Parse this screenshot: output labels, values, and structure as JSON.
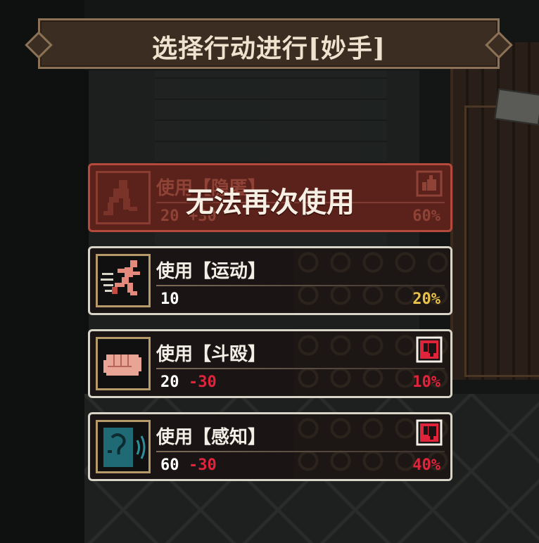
{
  "header": {
    "title": "选择行动进行[妙手]"
  },
  "options": [
    {
      "label": "使用【隐匿】",
      "base": "20",
      "modifier": "+30",
      "chance": "60%",
      "icon": "sneak-icon",
      "badge": "thumbs-up-icon",
      "disabled": true,
      "overlay": "无法再次使用"
    },
    {
      "label": "使用【运动】",
      "base": "10",
      "modifier": "",
      "chance": "20%",
      "chance_color": "#e8c04a",
      "icon": "running-icon",
      "badge": "",
      "disabled": false
    },
    {
      "label": "使用【斗殴】",
      "base": "20",
      "modifier": "-30",
      "chance": "10%",
      "chance_color": "#e0243c",
      "icon": "fist-icon",
      "badge": "thumbs-down-icon",
      "disabled": false
    },
    {
      "label": "使用【感知】",
      "base": "60",
      "modifier": "-30",
      "chance": "40%",
      "chance_color": "#e0243c",
      "icon": "perception-ear-icon",
      "badge": "thumbs-down-icon",
      "disabled": false
    }
  ],
  "colors": {
    "penalty": "#e0243c",
    "neutral": "#e8c04a",
    "accent_border": "#b69a6a"
  }
}
